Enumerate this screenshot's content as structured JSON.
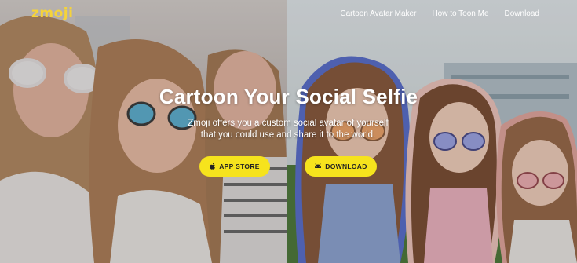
{
  "brand": {
    "logo": "zmoji",
    "logo_color": "#f5d33a"
  },
  "nav": {
    "links": [
      {
        "label": "Cartoon Avatar Maker"
      },
      {
        "label": "How to Toon Me"
      },
      {
        "label": "Download"
      }
    ]
  },
  "hero": {
    "title": "Cartoon Your Social Selfie",
    "subtitle_line1": "Zmoji offers you a custom social avatar of yourself",
    "subtitle_line2": "that you could use and share it to the world."
  },
  "buttons": {
    "app_store": {
      "label": "APP STORE",
      "icon": "apple-icon"
    },
    "download": {
      "label": "DOWNLOAD",
      "icon": "android-icon"
    },
    "color": "#f6e31d"
  }
}
